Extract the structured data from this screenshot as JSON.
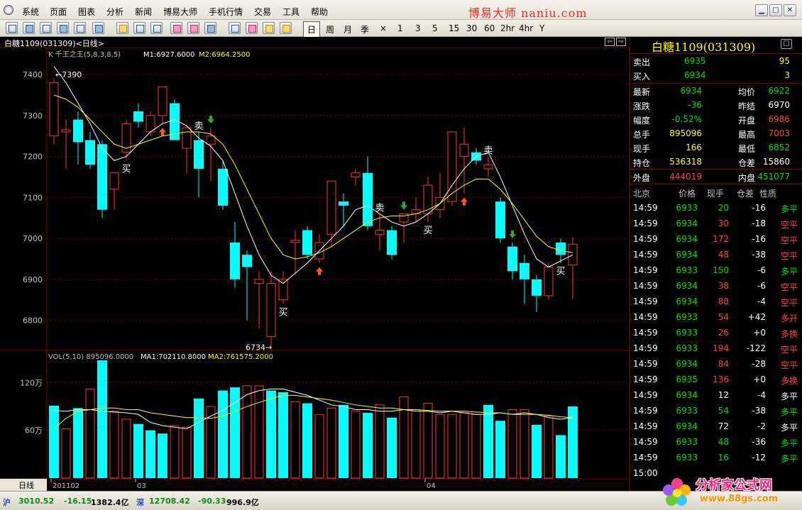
{
  "menu": {
    "items": [
      "系统",
      "页面",
      "图表",
      "分析",
      "新闻",
      "博易大师",
      "手机行情",
      "交易",
      "工具",
      "帮助"
    ],
    "brand": "博易大师 naniu.com"
  },
  "toolbar": {
    "periods": [
      "日",
      "周",
      "月",
      "季",
      "×",
      "1",
      "3",
      "5",
      "15",
      "30",
      "60",
      "2hr",
      "4hr",
      "Y"
    ],
    "active_period": "日"
  },
  "chart_header": {
    "title": "白糖1109(031309)<日线>",
    "indicator": "K  千王之王(5,8,3,8,5)",
    "m1": "M1:6927.6000",
    "m2": "M2:6964.2500"
  },
  "volume_header": {
    "name": "VOL(5,10) 895096.0000",
    "ma1": "MA1:702110.8000",
    "ma2": "MA2:761575.2000"
  },
  "chart_data": [
    {
      "type": "candlestick",
      "y_ticks": [
        "7400",
        "7300",
        "7200",
        "7100",
        "7000",
        "6900",
        "6800"
      ],
      "ylim": [
        6730,
        7440
      ],
      "x_labels": [
        {
          "index": 0,
          "label": "201102"
        },
        {
          "index": 7,
          "label": "03"
        },
        {
          "index": 31,
          "label": "04"
        }
      ],
      "high_label": "←7390",
      "low_label": "6734→",
      "candles": [
        {
          "o": 7250,
          "h": 7390,
          "l": 7230,
          "c": 7380
        },
        {
          "o": 7260,
          "h": 7290,
          "l": 7170,
          "c": 7265
        },
        {
          "o": 7290,
          "h": 7310,
          "l": 7180,
          "c": 7235
        },
        {
          "o": 7240,
          "h": 7260,
          "l": 7170,
          "c": 7180
        },
        {
          "o": 7230,
          "h": 7240,
          "l": 7050,
          "c": 7070
        },
        {
          "o": 7120,
          "h": 7160,
          "l": 7070,
          "c": 7160
        },
        {
          "o": 7210,
          "h": 7290,
          "l": 7190,
          "c": 7280
        },
        {
          "o": 7310,
          "h": 7330,
          "l": 7270,
          "c": 7285
        },
        {
          "o": 7260,
          "h": 7310,
          "l": 7250,
          "c": 7300
        },
        {
          "o": 7300,
          "h": 7370,
          "l": 7280,
          "c": 7370
        },
        {
          "o": 7330,
          "h": 7340,
          "l": 7240,
          "c": 7240
        },
        {
          "o": 7220,
          "h": 7280,
          "l": 7160,
          "c": 7270
        },
        {
          "o": 7240,
          "h": 7260,
          "l": 7100,
          "c": 7170
        },
        {
          "o": 7230,
          "h": 7270,
          "l": 7140,
          "c": 7250
        },
        {
          "o": 7170,
          "h": 7190,
          "l": 7070,
          "c": 7080
        },
        {
          "o": 6990,
          "h": 7040,
          "l": 6880,
          "c": 6900
        },
        {
          "o": 6960,
          "h": 6970,
          "l": 6800,
          "c": 6930
        },
        {
          "o": 6890,
          "h": 6920,
          "l": 6780,
          "c": 6900
        },
        {
          "o": 6760,
          "h": 6920,
          "l": 6734,
          "c": 6890
        },
        {
          "o": 6850,
          "h": 6920,
          "l": 6840,
          "c": 6900
        },
        {
          "o": 6990,
          "h": 7020,
          "l": 6910,
          "c": 6995
        },
        {
          "o": 7020,
          "h": 7030,
          "l": 6950,
          "c": 6960
        },
        {
          "o": 6950,
          "h": 7010,
          "l": 6940,
          "c": 6990
        },
        {
          "o": 7010,
          "h": 7090,
          "l": 6980,
          "c": 7140
        },
        {
          "o": 7090,
          "h": 7110,
          "l": 7030,
          "c": 7080
        },
        {
          "o": 7150,
          "h": 7170,
          "l": 7130,
          "c": 7160
        },
        {
          "o": 7160,
          "h": 7200,
          "l": 7020,
          "c": 7030
        },
        {
          "o": 7010,
          "h": 7060,
          "l": 6970,
          "c": 7020
        },
        {
          "o": 7020,
          "h": 7030,
          "l": 6950,
          "c": 6960
        },
        {
          "o": 7040,
          "h": 7060,
          "l": 6990,
          "c": 7060
        },
        {
          "o": 7060,
          "h": 7100,
          "l": 7040,
          "c": 7070
        },
        {
          "o": 7060,
          "h": 7150,
          "l": 7040,
          "c": 7130
        },
        {
          "o": 7070,
          "h": 7160,
          "l": 7050,
          "c": 7100
        },
        {
          "o": 7090,
          "h": 7260,
          "l": 7080,
          "c": 7260
        },
        {
          "o": 7200,
          "h": 7270,
          "l": 7110,
          "c": 7230
        },
        {
          "o": 7210,
          "h": 7220,
          "l": 7180,
          "c": 7190
        },
        {
          "o": 7170,
          "h": 7200,
          "l": 7150,
          "c": 7180
        },
        {
          "o": 7090,
          "h": 7100,
          "l": 6990,
          "c": 7000
        },
        {
          "o": 6980,
          "h": 6990,
          "l": 6900,
          "c": 6920
        },
        {
          "o": 6940,
          "h": 6960,
          "l": 6840,
          "c": 6900
        },
        {
          "o": 6900,
          "h": 6910,
          "l": 6820,
          "c": 6860
        },
        {
          "o": 6860,
          "h": 6940,
          "l": 6850,
          "c": 6930
        },
        {
          "o": 6990,
          "h": 7000,
          "l": 6940,
          "c": 6960
        },
        {
          "o": 6935,
          "h": 7003,
          "l": 6852,
          "c": 6986
        }
      ],
      "ma_fast": [
        7420,
        7380,
        7330,
        7280,
        7220,
        7190,
        7200,
        7230,
        7260,
        7280,
        7290,
        7275,
        7245,
        7225,
        7190,
        7110,
        7030,
        6960,
        6910,
        6890,
        6915,
        6940,
        6970,
        7000,
        7030,
        7070,
        7080,
        7060,
        7040,
        7030,
        7040,
        7060,
        7085,
        7130,
        7170,
        7200,
        7210,
        7150,
        7080,
        7010,
        6950,
        6930,
        6945,
        6960
      ],
      "ma_slow": [
        7350,
        7340,
        7320,
        7290,
        7260,
        7230,
        7220,
        7230,
        7240,
        7250,
        7255,
        7260,
        7260,
        7255,
        7230,
        7180,
        7120,
        7060,
        7000,
        6960,
        6950,
        6955,
        6965,
        6980,
        7000,
        7020,
        7040,
        7050,
        7055,
        7055,
        7060,
        7070,
        7085,
        7110,
        7130,
        7145,
        7145,
        7120,
        7085,
        7045,
        7005,
        6980,
        6970,
        6965
      ],
      "signals": [
        {
          "index": 6,
          "text": "买"
        },
        {
          "index": 12,
          "text": "卖"
        },
        {
          "index": 19,
          "text": "买"
        },
        {
          "index": 27,
          "text": "卖"
        },
        {
          "index": 31,
          "text": "买"
        },
        {
          "index": 36,
          "text": "卖"
        },
        {
          "index": 42,
          "text": "买"
        }
      ],
      "arrows": [
        {
          "index": 9,
          "dir": "up"
        },
        {
          "index": 13,
          "dir": "down"
        },
        {
          "index": 22,
          "dir": "up"
        },
        {
          "index": 29,
          "dir": "down"
        },
        {
          "index": 34,
          "dir": "up"
        },
        {
          "index": 38,
          "dir": "down"
        }
      ]
    },
    {
      "type": "bar",
      "y_ticks": [
        "120万",
        "60万"
      ],
      "y_tick_values": [
        120,
        60
      ],
      "ylim": [
        0,
        148
      ],
      "unit": "万",
      "values": [
        91,
        62,
        88,
        112,
        148,
        84,
        74,
        68,
        60,
        56,
        66,
        64,
        100,
        90,
        110,
        114,
        116,
        116,
        110,
        108,
        96,
        94,
        80,
        88,
        92,
        84,
        82,
        92,
        76,
        102,
        86,
        94,
        80,
        80,
        82,
        80,
        92,
        72,
        86,
        86,
        67,
        78,
        54,
        90
      ],
      "ma1": [
        85,
        84,
        86,
        86,
        84,
        83,
        82,
        80,
        70,
        66,
        64,
        62,
        70,
        78,
        85,
        95,
        105,
        110,
        112,
        112,
        108,
        104,
        98,
        92,
        90,
        86,
        86,
        84,
        84,
        86,
        84,
        84,
        82,
        84,
        82,
        80,
        80,
        82,
        80,
        82,
        80,
        76,
        74,
        76
      ],
      "ma2": [
        62,
        75,
        84,
        86,
        88,
        88,
        86,
        86,
        82,
        80,
        78,
        76,
        76,
        75,
        78,
        84,
        90,
        95,
        100,
        104,
        104,
        102,
        100,
        98,
        95,
        92,
        90,
        88,
        88,
        86,
        86,
        85,
        84,
        84,
        84,
        83,
        82,
        82,
        80,
        80,
        80,
        79,
        77,
        76
      ],
      "up_flags": [
        0,
        1,
        0,
        1,
        0,
        1,
        1,
        0,
        0,
        0,
        1,
        1,
        0,
        1,
        0,
        0,
        1,
        1,
        0,
        0,
        1,
        0,
        1,
        1,
        0,
        1,
        0,
        1,
        0,
        1,
        1,
        1,
        1,
        1,
        1,
        1,
        0,
        0,
        1,
        1,
        0,
        1,
        0,
        0
      ]
    }
  ],
  "quote": {
    "title": "白糖1109(031309)",
    "sell": {
      "label": "卖出",
      "price": "6935",
      "vol": "95"
    },
    "buy": {
      "label": "买入",
      "price": "6934",
      "vol": "3"
    },
    "rows": [
      {
        "l1": "最新",
        "v1": "6934",
        "c1": "#00e000",
        "l2": "均价",
        "v2": "6922",
        "c2": "#00e000"
      },
      {
        "l1": "涨跌",
        "v1": "-36",
        "c1": "#00e000",
        "l2": "昨结",
        "v2": "6970",
        "c2": "#ffffff"
      },
      {
        "l1": "幅度",
        "v1": "-0.52%",
        "c1": "#00e000",
        "l2": "开盘",
        "v2": "6986",
        "c2": "#ff4040"
      },
      {
        "l1": "总手",
        "v1": "895096",
        "c1": "#ffff00",
        "l2": "最高",
        "v2": "7003",
        "c2": "#ff4040"
      },
      {
        "l1": "现手",
        "v1": "166",
        "c1": "#ffff00",
        "l2": "最低",
        "v2": "6852",
        "c2": "#00e000"
      },
      {
        "l1": "持仓",
        "v1": "536318",
        "c1": "#ffff00",
        "l2": "仓差",
        "v2": "15860",
        "c2": "#ffffff"
      }
    ],
    "outer": {
      "label": "外盘",
      "value": "444019",
      "label2": "内盘",
      "value2": "451077"
    },
    "tick_header": [
      "北京",
      "价格",
      "现手",
      "仓差",
      "性质"
    ],
    "ticks": [
      {
        "t": "14:59",
        "p": "6933",
        "v": "20",
        "d": "-16",
        "n": "多平",
        "pc": "#00e000",
        "vc": "#00e000",
        "nc": "#00e000"
      },
      {
        "t": "14:59",
        "p": "6934",
        "v": "30",
        "d": "-18",
        "n": "空平",
        "pc": "#00e000",
        "vc": "#ff4040",
        "nc": "#ff4040"
      },
      {
        "t": "14:59",
        "p": "6934",
        "v": "172",
        "d": "-16",
        "n": "空平",
        "pc": "#00e000",
        "vc": "#ff4040",
        "nc": "#ff4040"
      },
      {
        "t": "14:59",
        "p": "6934",
        "v": "48",
        "d": "-38",
        "n": "空平",
        "pc": "#00e000",
        "vc": "#ff4040",
        "nc": "#ff4040"
      },
      {
        "t": "14:59",
        "p": "6933",
        "v": "150",
        "d": "-6",
        "n": "多平",
        "pc": "#00e000",
        "vc": "#00e000",
        "nc": "#00e000"
      },
      {
        "t": "14:59",
        "p": "6934",
        "v": "38",
        "d": "-6",
        "n": "空平",
        "pc": "#00e000",
        "vc": "#ff4040",
        "nc": "#ff4040"
      },
      {
        "t": "14:59",
        "p": "6934",
        "v": "88",
        "d": "-4",
        "n": "空平",
        "pc": "#00e000",
        "vc": "#ff4040",
        "nc": "#ff4040"
      },
      {
        "t": "14:59",
        "p": "6933",
        "v": "54",
        "d": "+42",
        "n": "多开",
        "pc": "#00e000",
        "vc": "#ff4040",
        "nc": "#ff4040"
      },
      {
        "t": "14:59",
        "p": "6933",
        "v": "26",
        "d": "+0",
        "n": "多换",
        "pc": "#00e000",
        "vc": "#ff4040",
        "nc": "#ff4040"
      },
      {
        "t": "14:59",
        "p": "6933",
        "v": "194",
        "d": "-122",
        "n": "空平",
        "pc": "#00e000",
        "vc": "#ff4040",
        "nc": "#ff4040"
      },
      {
        "t": "14:59",
        "p": "6934",
        "v": "84",
        "d": "-28",
        "n": "空平",
        "pc": "#00e000",
        "vc": "#ff4040",
        "nc": "#ff4040"
      },
      {
        "t": "14:59",
        "p": "6935",
        "v": "136",
        "d": "+0",
        "n": "多换",
        "pc": "#00e000",
        "vc": "#ff4040",
        "nc": "#ff4040"
      },
      {
        "t": "14:59",
        "p": "6934",
        "v": "12",
        "d": "-4",
        "n": "多平",
        "pc": "#00e000",
        "vc": "#ffffff",
        "nc": "#ffffff"
      },
      {
        "t": "14:59",
        "p": "6933",
        "v": "54",
        "d": "-38",
        "n": "多平",
        "pc": "#00e000",
        "vc": "#00e000",
        "nc": "#00e000"
      },
      {
        "t": "14:59",
        "p": "6934",
        "v": "72",
        "d": "-2",
        "n": "多平",
        "pc": "#00e000",
        "vc": "#ffffff",
        "nc": "#ffffff"
      },
      {
        "t": "14:59",
        "p": "6933",
        "v": "48",
        "d": "-36",
        "n": "多平",
        "pc": "#00e000",
        "vc": "#00e000",
        "nc": "#00e000"
      },
      {
        "t": "14:59",
        "p": "6933",
        "v": "16",
        "d": "-12",
        "n": "多平",
        "pc": "#00e000",
        "vc": "#00e000",
        "nc": "#00e000"
      },
      {
        "t": "15:00",
        "p": "",
        "v": "",
        "d": "",
        "n": "",
        "pc": "#00e000",
        "vc": "#00e000",
        "nc": "#00e000"
      }
    ]
  },
  "status": {
    "sh_label": "沪",
    "sh_index": "3010.52",
    "sh_change": "-16.15",
    "sh_amount": "1382.4亿",
    "sz_label": "深",
    "sz_index": "12708.42",
    "sz_change": "-90.33",
    "sz_amount": "996.9亿",
    "period_tab": "日线"
  },
  "watermark": {
    "text": "分析家公式网",
    "url": "www.88gs.com"
  },
  "colors": {
    "up": "#ff3232",
    "down": "#00ffff",
    "ma_fast": "#ffffff",
    "ma_slow": "#ffff00",
    "grid": "#800000"
  }
}
